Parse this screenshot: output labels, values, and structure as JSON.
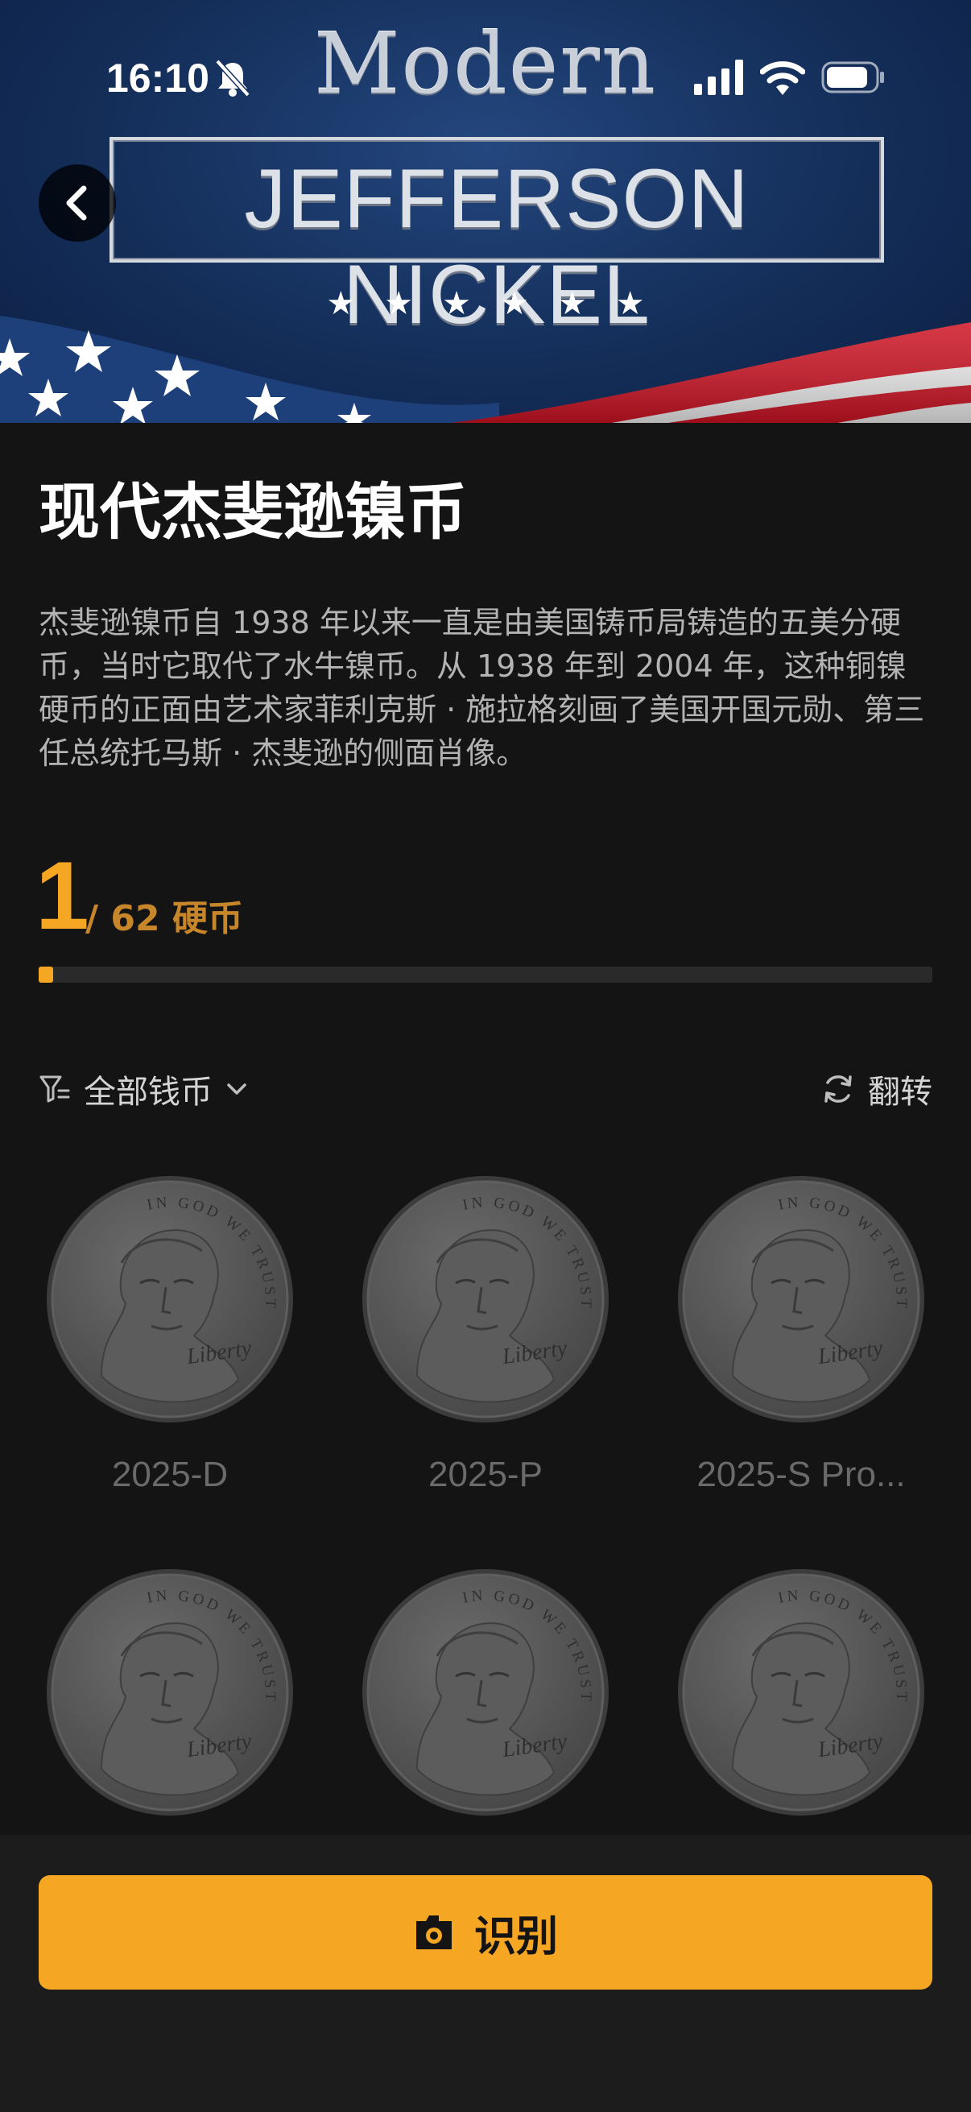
{
  "status_bar": {
    "time": "16:10"
  },
  "hero": {
    "title_top": "Modern",
    "title_main": "JEFFERSON NICKEL",
    "stars": "★★★★★★"
  },
  "page": {
    "title": "现代杰斐逊镍币",
    "description": "杰斐逊镍币自 1938 年以来一直是由美国铸币局铸造的五美分硬币，当时它取代了水牛镍币。从 1938 年到 2004 年，这种铜镍硬币的正面由艺术家菲利克斯 · 施拉格刻画了美国开国元勋、第三任总统托马斯 · 杰斐逊的侧面肖像。"
  },
  "collection": {
    "collected": "1",
    "total_label": "/ 62 硬币",
    "progress_fraction": 0.016
  },
  "toolbar": {
    "filter_label": "全部钱币",
    "flip_label": "翻转"
  },
  "coins": [
    {
      "label": "2025-D"
    },
    {
      "label": "2025-P"
    },
    {
      "label": "2025-S Pro..."
    },
    {
      "label": ""
    },
    {
      "label": ""
    },
    {
      "label": ""
    }
  ],
  "coin_inscriptions": {
    "motto": "IN GOD WE TRUST",
    "liberty": "Liberty"
  },
  "actions": {
    "identify_label": "识别"
  },
  "colors": {
    "accent": "#f5a623",
    "background": "#141414",
    "coin": "#5a5a5a"
  }
}
